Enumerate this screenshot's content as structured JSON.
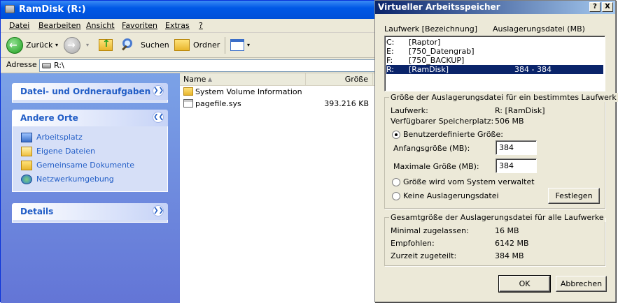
{
  "explorer": {
    "title": "RamDisk (R:)",
    "menu": [
      "Datei",
      "Bearbeiten",
      "Ansicht",
      "Favoriten",
      "Extras",
      "?"
    ],
    "toolbar": {
      "back": "Zurück",
      "search": "Suchen",
      "folders": "Ordner"
    },
    "address": {
      "label": "Adresse",
      "value": "R:\\"
    },
    "panels": {
      "file_tasks": "Datei- und Ordneraufgaben",
      "other_places": {
        "title": "Andere Orte",
        "links": [
          "Arbeitsplatz",
          "Eigene Dateien",
          "Gemeinsame Dokumente",
          "Netzwerkumgebung"
        ]
      },
      "details": "Details"
    },
    "columns": {
      "name": "Name",
      "size": "Größe"
    },
    "files": [
      {
        "name": "System Volume Information",
        "size": "",
        "type": "folder"
      },
      {
        "name": "pagefile.sys",
        "size": "393.216 KB",
        "type": "file"
      }
    ]
  },
  "dialog": {
    "title": "Virtueller Arbeitsspeicher",
    "help_btn": "?",
    "close_btn": "X",
    "list_headers": {
      "drive": "Laufwerk [Bezeichnung]",
      "pagefile": "Auslagerungsdatei (MB)"
    },
    "drives": [
      {
        "letter": "C:",
        "label": "[Raptor]",
        "size": ""
      },
      {
        "letter": "E:",
        "label": "[750_Datengrab]",
        "size": ""
      },
      {
        "letter": "F:",
        "label": "[750_BACKUP]",
        "size": ""
      },
      {
        "letter": "R:",
        "label": "[RamDisk]",
        "size": "384 - 384",
        "selected": true
      }
    ],
    "drive_group": {
      "title": "Größe der Auslagerungsdatei für ein bestimmtes Laufwerk",
      "drive_label": "Laufwerk:",
      "drive_value": "R:  [RamDisk]",
      "space_label": "Verfügbarer Speicherplatz:",
      "space_value": "506 MB",
      "custom_size": "Benutzerdefinierte Größe:",
      "initial_label": "Anfangsgröße (MB):",
      "initial_value": "384",
      "max_label": "Maximale Größe (MB):",
      "max_value": "384",
      "system_managed": "Größe wird vom System verwaltet",
      "no_pagefile": "Keine Auslagerungsdatei",
      "set_button": "Festlegen"
    },
    "total_group": {
      "title": "Gesamtgröße der Auslagerungsdatei für alle Laufwerke",
      "min_label": "Minimal zugelassen:",
      "min_value": "16 MB",
      "rec_label": "Empfohlen:",
      "rec_value": "6142 MB",
      "cur_label": "Zurzeit zugeteilt:",
      "cur_value": "384 MB"
    },
    "ok_button": "OK",
    "cancel_button": "Abbrechen"
  },
  "colors": {
    "xp_blue": "#0058e6",
    "task_pane": "#6375d6",
    "link": "#215dc6",
    "selection": "#0a246a",
    "dialog_bg": "#ece9d8"
  }
}
